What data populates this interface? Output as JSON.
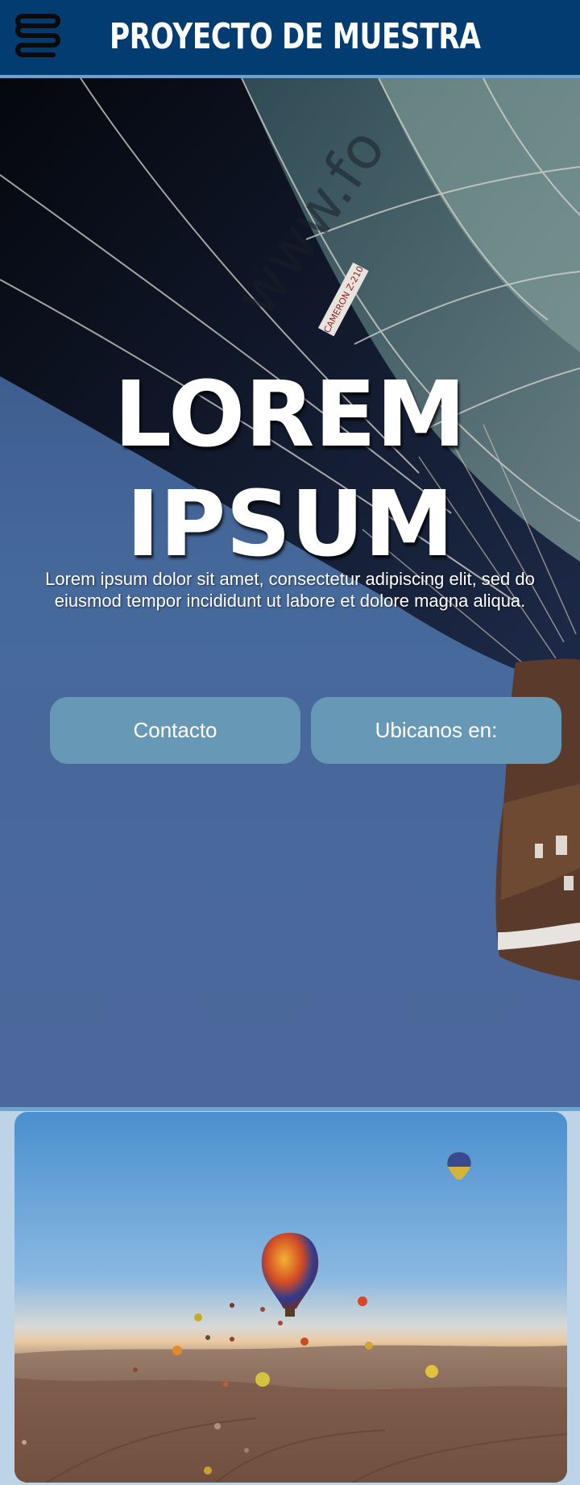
{
  "header": {
    "title": "PROYECTO DE MUESTRA",
    "menu_icon": "hamburger-coil-icon",
    "background": "#033c71",
    "accent": "#6fa3cc"
  },
  "hero": {
    "title_line1": "LOREM",
    "title_line2": "IPSUM",
    "text": "Lorem ipsum dolor sit amet, consectetur adipiscing elit, sed do eiusmod tempor incididunt ut labore et dolore magna aliqua.",
    "balloon_lettering": "CAMERON Z-210",
    "balloon_watermark": "www.fo"
  },
  "buttons": {
    "contact_label": "Contacto",
    "location_label": "Ubicanos en:",
    "color": "#6799b6"
  },
  "gallery": {
    "image": "hot-air-balloons-landscape-photo"
  }
}
